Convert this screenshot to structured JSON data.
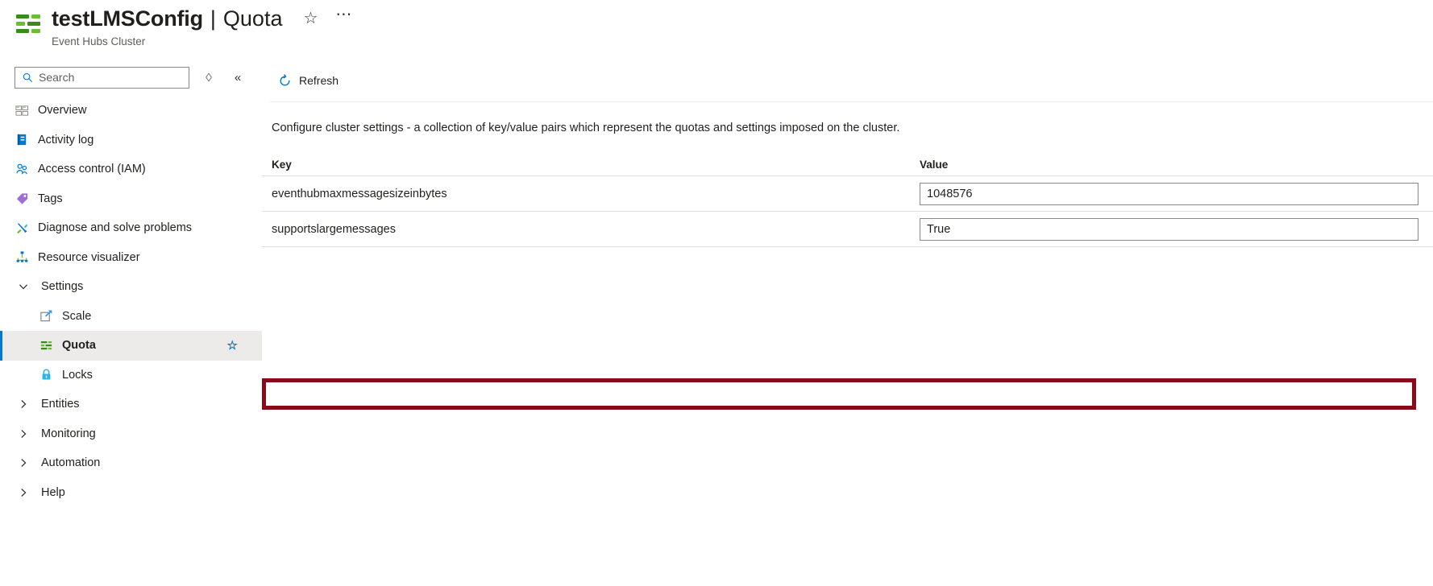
{
  "header": {
    "resource_name": "testLMSConfig",
    "separator": "|",
    "page_name": "Quota",
    "subtitle": "Event Hubs Cluster",
    "favorite_icon": "star-icon",
    "more_icon": "ellipsis-icon",
    "resource_icon": "event-hubs-cluster-icon"
  },
  "sidebar": {
    "search": {
      "placeholder": "Search",
      "value": "",
      "icon": "search-icon"
    },
    "actions": [
      {
        "name": "expand-collapse-toggle-icon",
        "glyph": "◇"
      },
      {
        "name": "collapse-panel-icon",
        "glyph": "«"
      }
    ],
    "items": [
      {
        "label": "Overview",
        "icon": "overview-icon",
        "type": "item",
        "selected": false
      },
      {
        "label": "Activity log",
        "icon": "activity-log-icon",
        "type": "item",
        "selected": false
      },
      {
        "label": "Access control (IAM)",
        "icon": "access-control-icon",
        "type": "item",
        "selected": false
      },
      {
        "label": "Tags",
        "icon": "tags-icon",
        "type": "item",
        "selected": false
      },
      {
        "label": "Diagnose and solve problems",
        "icon": "diagnose-icon",
        "type": "item",
        "selected": false
      },
      {
        "label": "Resource visualizer",
        "icon": "resource-visualizer-icon",
        "type": "item",
        "selected": false
      },
      {
        "label": "Settings",
        "icon": "chevron-down-icon",
        "type": "group-expanded",
        "selected": false
      },
      {
        "label": "Scale",
        "icon": "scale-icon",
        "type": "child",
        "selected": false
      },
      {
        "label": "Quota",
        "icon": "quota-icon",
        "type": "child",
        "selected": true,
        "favorite": "☆"
      },
      {
        "label": "Locks",
        "icon": "lock-icon",
        "type": "child",
        "selected": false
      },
      {
        "label": "Entities",
        "icon": "chevron-right-icon",
        "type": "group-collapsed",
        "selected": false
      },
      {
        "label": "Monitoring",
        "icon": "chevron-right-icon",
        "type": "group-collapsed",
        "selected": false
      },
      {
        "label": "Automation",
        "icon": "chevron-right-icon",
        "type": "group-collapsed",
        "selected": false
      },
      {
        "label": "Help",
        "icon": "chevron-right-icon",
        "type": "group-collapsed",
        "selected": false
      }
    ]
  },
  "main": {
    "toolbar": {
      "refresh_label": "Refresh",
      "refresh_icon": "refresh-icon"
    },
    "description": "Configure cluster settings - a collection of key/value pairs which represent the quotas and settings imposed on the cluster.",
    "table": {
      "columns": [
        {
          "label": "Key"
        },
        {
          "label": "Value"
        }
      ],
      "rows": [
        {
          "key": "eventhubmaxmessagesizeinbytes",
          "value": "1048576",
          "highlighted": false
        },
        {
          "key": "supportslargemessages",
          "value": "True",
          "highlighted": true
        }
      ]
    }
  },
  "annotation": {
    "highlight_color": "#8b0a1a",
    "highlight_target": "supportslargemessages"
  },
  "colors": {
    "accent": "#0078d4",
    "selected_bg": "#edebe9",
    "border": "#e1dfdd",
    "text": "#201f1e",
    "muted_text": "#605e5c",
    "brand_green_dark": "#3a8a1e",
    "brand_green_light": "#6bbd2f"
  }
}
